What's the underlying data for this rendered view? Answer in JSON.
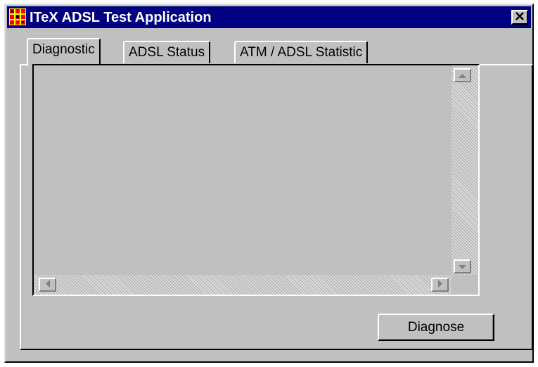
{
  "window": {
    "title": "ITeX ADSL Test Application",
    "icon": "app-grid-icon",
    "close_icon": "close-x-icon"
  },
  "tabs": [
    {
      "label": "Diagnostic",
      "active": true
    },
    {
      "label": "ADSL Status",
      "active": false
    },
    {
      "label": "ATM / ADSL Statistic",
      "active": false
    }
  ],
  "output": {
    "text": "",
    "scrollbar_icons": [
      "arrow-up-icon",
      "arrow-down-icon",
      "arrow-left-icon",
      "arrow-right-icon"
    ]
  },
  "actions": {
    "diagnose_label": "Diagnose"
  },
  "colors": {
    "titlebar": "#000080",
    "face": "#c0c0c0",
    "title_text": "#ffffff"
  }
}
